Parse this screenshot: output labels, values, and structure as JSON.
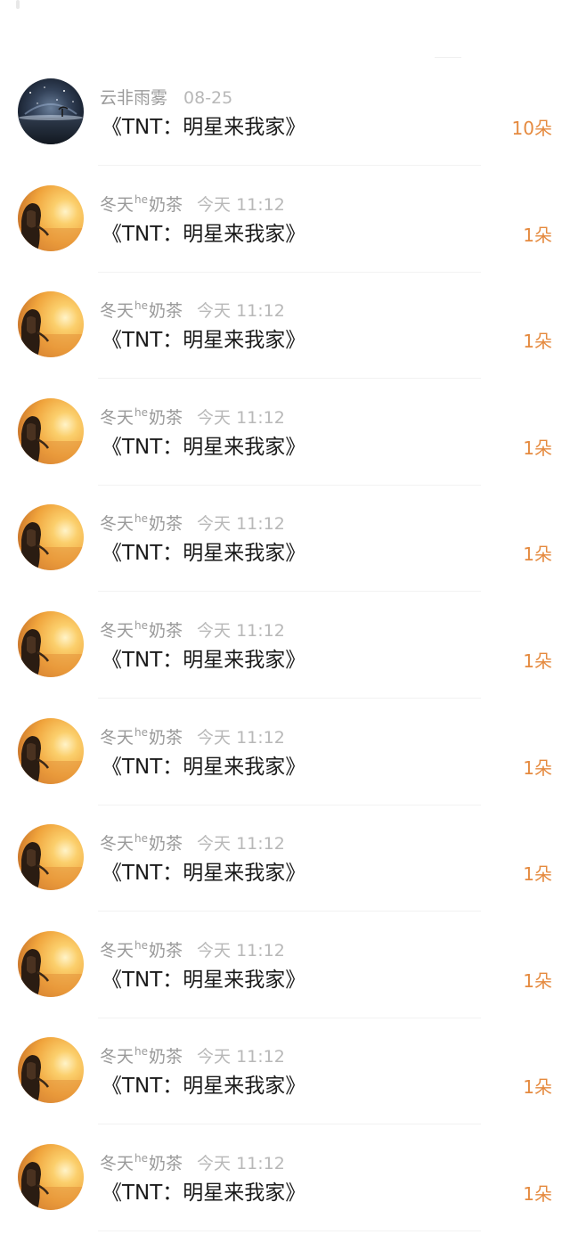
{
  "gifts": [
    {
      "user": "云非雨雾",
      "user_sup": "",
      "user_suffix": "",
      "time": "08-25",
      "title": "《TNT：明星来我家》",
      "amount": "10朵",
      "avatar_icon": "starry-night-avatar"
    },
    {
      "user": "冬天",
      "user_sup": "he",
      "user_suffix": "奶茶",
      "time": "今天 11:12",
      "title": "《TNT：明星来我家》",
      "amount": "1朵",
      "avatar_icon": "sunset-girl-avatar"
    },
    {
      "user": "冬天",
      "user_sup": "he",
      "user_suffix": "奶茶",
      "time": "今天 11:12",
      "title": "《TNT：明星来我家》",
      "amount": "1朵",
      "avatar_icon": "sunset-girl-avatar"
    },
    {
      "user": "冬天",
      "user_sup": "he",
      "user_suffix": "奶茶",
      "time": "今天 11:12",
      "title": "《TNT：明星来我家》",
      "amount": "1朵",
      "avatar_icon": "sunset-girl-avatar"
    },
    {
      "user": "冬天",
      "user_sup": "he",
      "user_suffix": "奶茶",
      "time": "今天 11:12",
      "title": "《TNT：明星来我家》",
      "amount": "1朵",
      "avatar_icon": "sunset-girl-avatar"
    },
    {
      "user": "冬天",
      "user_sup": "he",
      "user_suffix": "奶茶",
      "time": "今天 11:12",
      "title": "《TNT：明星来我家》",
      "amount": "1朵",
      "avatar_icon": "sunset-girl-avatar"
    },
    {
      "user": "冬天",
      "user_sup": "he",
      "user_suffix": "奶茶",
      "time": "今天 11:12",
      "title": "《TNT：明星来我家》",
      "amount": "1朵",
      "avatar_icon": "sunset-girl-avatar"
    },
    {
      "user": "冬天",
      "user_sup": "he",
      "user_suffix": "奶茶",
      "time": "今天 11:12",
      "title": "《TNT：明星来我家》",
      "amount": "1朵",
      "avatar_icon": "sunset-girl-avatar"
    },
    {
      "user": "冬天",
      "user_sup": "he",
      "user_suffix": "奶茶",
      "time": "今天 11:12",
      "title": "《TNT：明星来我家》",
      "amount": "1朵",
      "avatar_icon": "sunset-girl-avatar"
    },
    {
      "user": "冬天",
      "user_sup": "he",
      "user_suffix": "奶茶",
      "time": "今天 11:12",
      "title": "《TNT：明星来我家》",
      "amount": "1朵",
      "avatar_icon": "sunset-girl-avatar"
    },
    {
      "user": "冬天",
      "user_sup": "he",
      "user_suffix": "奶茶",
      "time": "今天 11:12",
      "title": "《TNT：明星来我家》",
      "amount": "1朵",
      "avatar_icon": "sunset-girl-avatar"
    }
  ],
  "colors": {
    "amount": "#e58a3f",
    "username": "#9a9a9a",
    "time": "#b8b8b8",
    "title": "#1a1a1a"
  }
}
